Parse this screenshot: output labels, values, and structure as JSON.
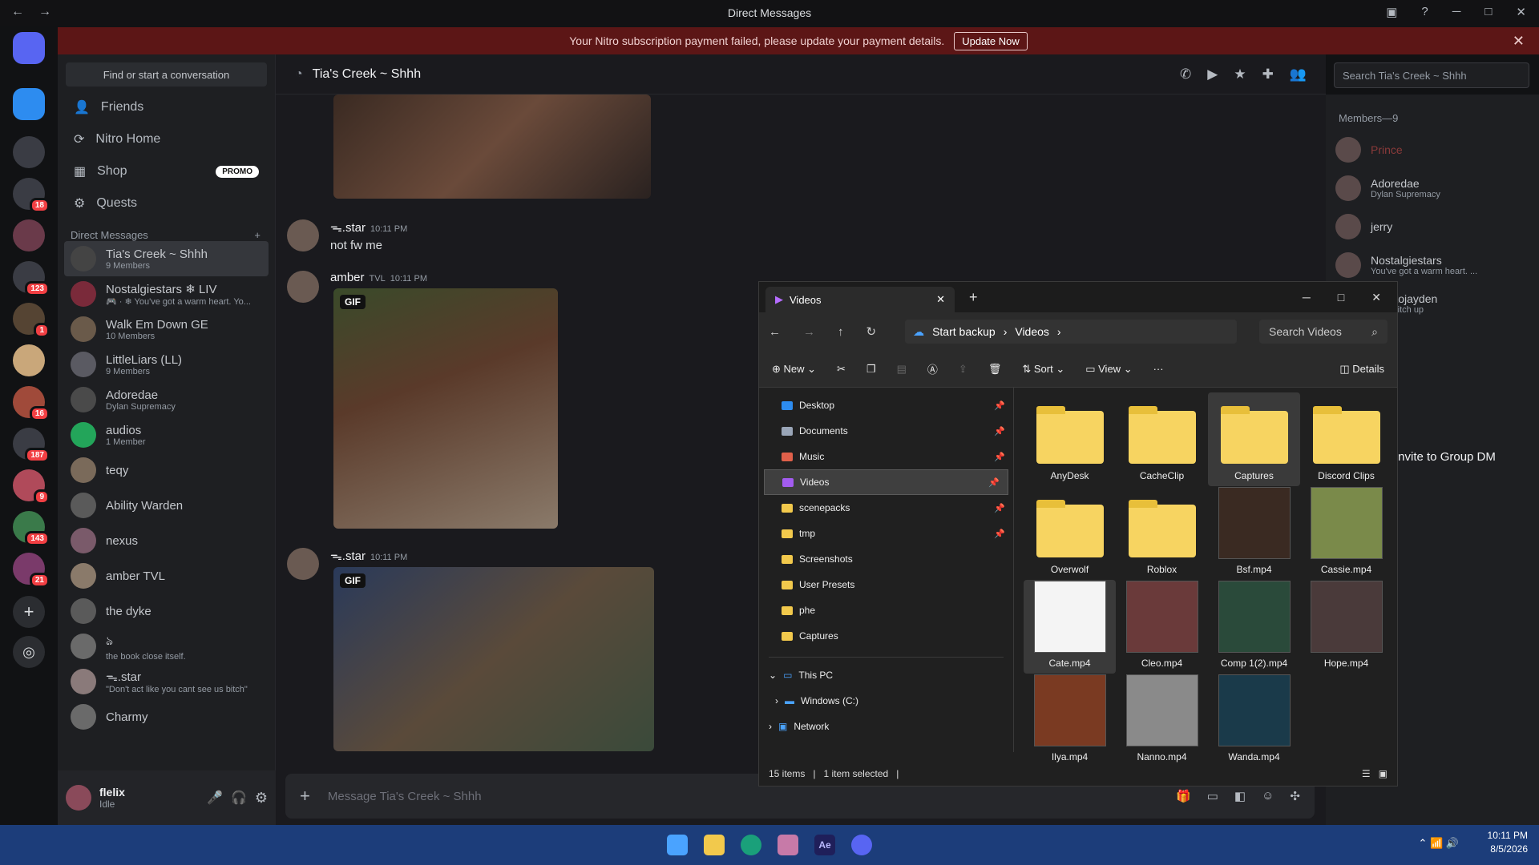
{
  "window": {
    "title": "Direct Messages",
    "back": "←",
    "fwd": "→",
    "inbox": "▣",
    "help": "?",
    "min": "─",
    "max": "□",
    "close": "✕"
  },
  "banner": {
    "text": "Your Nitro subscription payment failed, please update your payment details.",
    "button": "Update Now",
    "close": "✕"
  },
  "servers": [
    {
      "badge": ""
    },
    {
      "badge": ""
    },
    {
      "badge": ""
    },
    {
      "badge": "18"
    },
    {
      "badge": ""
    },
    {
      "badge": "123"
    },
    {
      "badge": "1"
    },
    {
      "badge": ""
    },
    {
      "badge": "16"
    },
    {
      "badge": "187"
    },
    {
      "badge": "9"
    },
    {
      "badge": "143"
    },
    {
      "badge": "21"
    }
  ],
  "dm_sidebar": {
    "find": "Find or start a conversation",
    "nav": [
      {
        "label": "Friends",
        "icon": "friends-icon"
      },
      {
        "label": "Nitro Home",
        "icon": "nitro-icon"
      },
      {
        "label": "Shop",
        "icon": "shop-icon",
        "promo": "PROMO"
      },
      {
        "label": "Quests",
        "icon": "quests-icon"
      }
    ],
    "dm_header": "Direct Messages",
    "add": "+",
    "dms": [
      {
        "name": "Tia's Creek ~ Shhh",
        "sub": "9 Members"
      },
      {
        "name": "Nostalgiestars ❄ LIV",
        "sub": "🎮 · ❄ You've got a warm heart. Yo..."
      },
      {
        "name": "Walk Em Down GE",
        "sub": "10 Members"
      },
      {
        "name": "LittleLiars (LL)",
        "sub": "9 Members"
      },
      {
        "name": "Adoredae",
        "sub": "Dylan Supremacy"
      },
      {
        "name": "audios",
        "sub": "1 Member"
      },
      {
        "name": "teqy",
        "sub": ""
      },
      {
        "name": "Ability Warden",
        "sub": ""
      },
      {
        "name": "nexus",
        "sub": ""
      },
      {
        "name": "amber TVL",
        "sub": ""
      },
      {
        "name": "the dyke",
        "sub": ""
      },
      {
        "name": "ঌ",
        "sub": "the book close itself."
      },
      {
        "name": "ᯓ.star",
        "sub": "\"Don't act like you cant see us bitch\""
      },
      {
        "name": "Charmy",
        "sub": ""
      }
    ]
  },
  "user": {
    "name": "flelix",
    "status": "Idle",
    "mic": "🎤",
    "headset": "🎧",
    "settings": "⚙"
  },
  "chat": {
    "channel": "Tia's Creek ~ Shhh",
    "search": "Search Tia's Creek ~ Shhh",
    "messages": [
      {
        "user": "ᯓ.star",
        "time": "10:11 PM",
        "text": "not fw me"
      },
      {
        "user": "amber",
        "tag": "TVL",
        "time": "10:11 PM",
        "text": ""
      },
      {
        "user": "ᯓ.star",
        "time": "10:11 PM",
        "text": ""
      }
    ],
    "gif_label": "GIF",
    "composer": "Message Tia's Creek ~ Shhh",
    "plus": "+"
  },
  "members": {
    "header": "Members—9",
    "list": [
      {
        "name": "Prince",
        "sub": ""
      },
      {
        "name": "Adoredae",
        "sub": "Dylan Supremacy"
      },
      {
        "name": "jerry",
        "sub": ""
      },
      {
        "name": "Nostalgiestars",
        "sub": "You've got a warm heart. ..."
      },
      {
        "name": "sirodtojayden",
        "sub": "eat a bitch up"
      }
    ],
    "invite": "Invite to Group DM"
  },
  "explorer": {
    "tab": "Videos",
    "new_tab": "+",
    "path": [
      "Start backup",
      "Videos"
    ],
    "search": "Search Videos",
    "toolbar": {
      "new": "New",
      "sort": "Sort",
      "view": "View",
      "more": "···",
      "details": "Details"
    },
    "nav": [
      {
        "label": "Desktop",
        "pin": true
      },
      {
        "label": "Documents",
        "pin": true
      },
      {
        "label": "Music",
        "pin": true
      },
      {
        "label": "Videos",
        "pin": true,
        "selected": true
      },
      {
        "label": "scenepacks",
        "pin": true
      },
      {
        "label": "tmp",
        "pin": true
      },
      {
        "label": "Screenshots",
        "pin": false
      },
      {
        "label": "User Presets",
        "pin": false
      },
      {
        "label": "phe",
        "pin": false
      },
      {
        "label": "Captures",
        "pin": false
      }
    ],
    "tree": [
      "This PC",
      "Windows (C:)",
      "Network"
    ],
    "items": [
      {
        "name": "AnyDesk",
        "type": "folder"
      },
      {
        "name": "CacheClip",
        "type": "folder"
      },
      {
        "name": "Captures",
        "type": "folder"
      },
      {
        "name": "Discord Clips",
        "type": "folder"
      },
      {
        "name": "Overwolf",
        "type": "folder"
      },
      {
        "name": "Roblox",
        "type": "folder"
      },
      {
        "name": "Bsf.mp4",
        "type": "video"
      },
      {
        "name": "Cassie.mp4",
        "type": "video"
      },
      {
        "name": "Cate.mp4",
        "type": "video"
      },
      {
        "name": "Cleo.mp4",
        "type": "video"
      },
      {
        "name": "Comp 1(2).mp4",
        "type": "video"
      },
      {
        "name": "Hope.mp4",
        "type": "video"
      },
      {
        "name": "Ilya.mp4",
        "type": "video"
      },
      {
        "name": "Nanno.mp4",
        "type": "video"
      },
      {
        "name": "Wanda.mp4",
        "type": "video"
      }
    ],
    "status": {
      "count": "15 items",
      "selected": "1 item selected"
    }
  },
  "taskbar": {
    "time": "10:11 PM",
    "date": "8/5/2026",
    "tray": "⌃ 📶 🔊"
  },
  "colors": {
    "accent": "#5865f2",
    "danger": "#f23f43",
    "banner": "#5c1616",
    "taskbar": "#1c3d7a"
  }
}
